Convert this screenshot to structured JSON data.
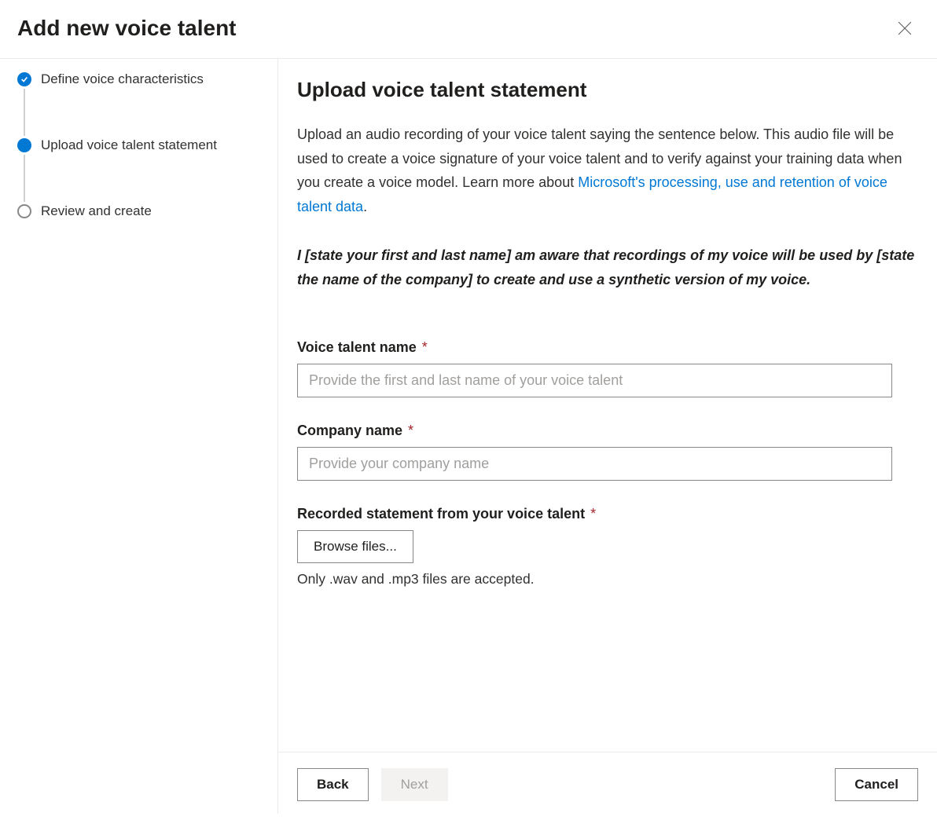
{
  "header": {
    "title": "Add new voice talent"
  },
  "sidebar": {
    "steps": [
      {
        "label": "Define voice characteristics"
      },
      {
        "label": "Upload voice talent statement"
      },
      {
        "label": "Review and create"
      }
    ]
  },
  "main": {
    "title": "Upload voice talent statement",
    "description_prefix": "Upload an audio recording of your voice talent saying the sentence below. This audio file will be used to create a voice signature of your voice talent and to verify against your training data when you create a voice model. Learn more about ",
    "description_link": "Microsoft's processing, use and retention of voice talent data",
    "description_suffix": ".",
    "statement": "I [state your first and last name] am aware that recordings of my voice will be used by [state the name of the company] to create and use a synthetic version of my voice.",
    "fields": {
      "name": {
        "label": "Voice talent name",
        "placeholder": "Provide the first and last name of your voice talent",
        "value": ""
      },
      "company": {
        "label": "Company name",
        "placeholder": "Provide your company name",
        "value": ""
      },
      "recorded": {
        "label": "Recorded statement from your voice talent",
        "browse_label": "Browse files...",
        "hint": "Only .wav and .mp3 files are accepted."
      }
    }
  },
  "footer": {
    "back": "Back",
    "next": "Next",
    "cancel": "Cancel"
  }
}
